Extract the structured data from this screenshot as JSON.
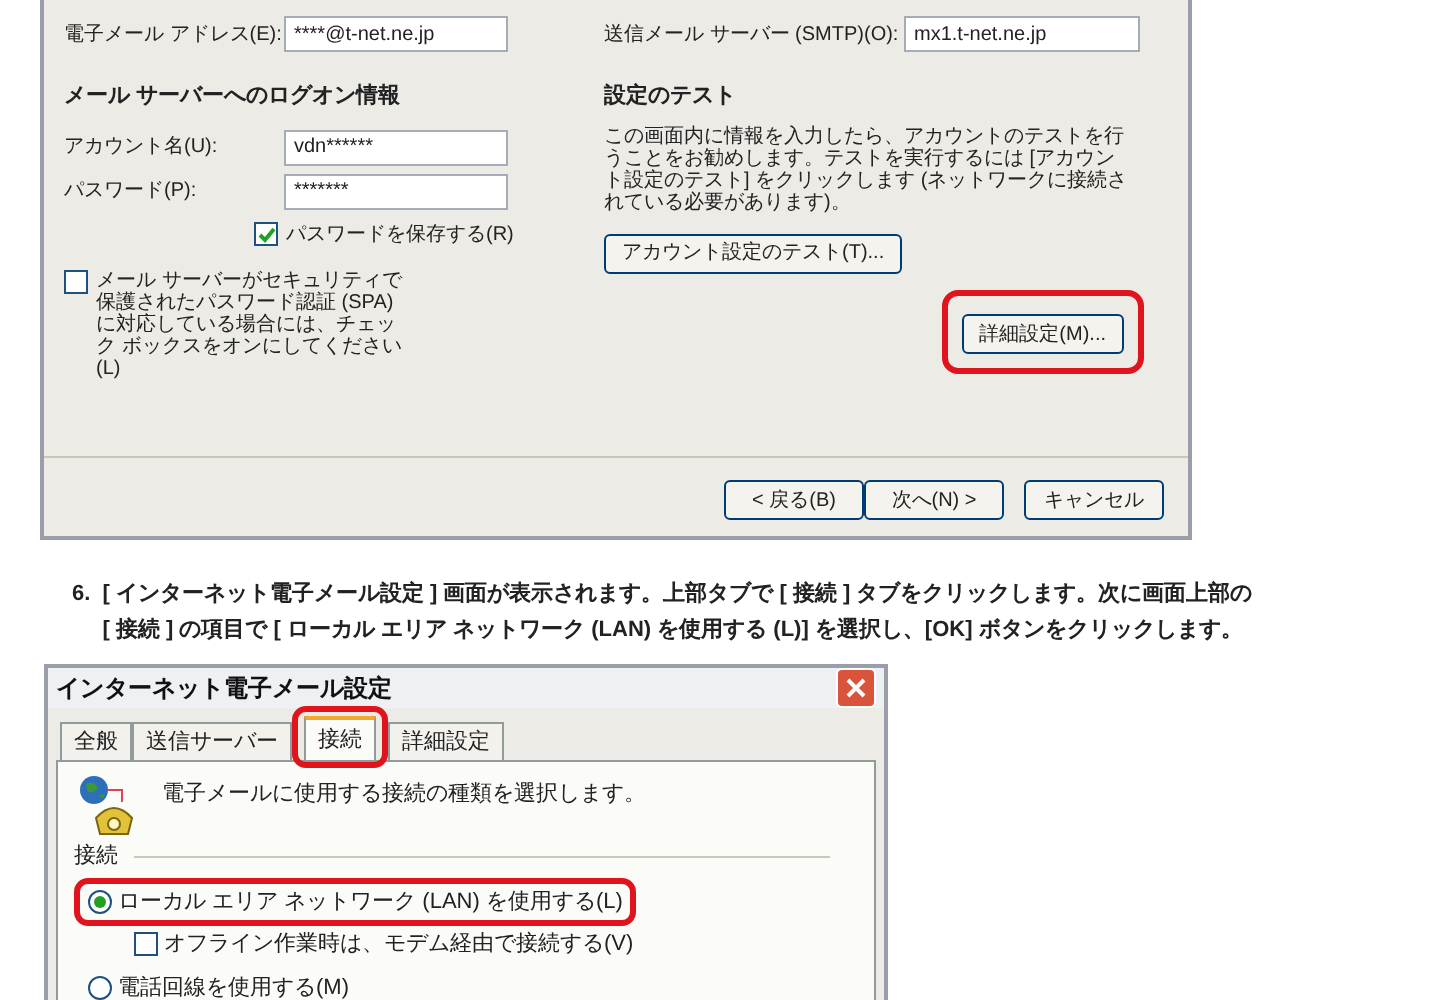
{
  "account_dialog": {
    "email": {
      "label": "電子メール アドレス(E):",
      "value": "****@t-net.ne.jp"
    },
    "smtp": {
      "label": "送信メール サーバー (SMTP)(O):",
      "value": "mx1.t-net.ne.jp"
    },
    "logon_section": {
      "title": "メール サーバーへのログオン情報",
      "account": {
        "label": "アカウント名(U):",
        "value": "vdn******"
      },
      "password": {
        "label": "パスワード(P):",
        "value": "*******"
      },
      "save_password": {
        "label": "パスワードを保存する(R)",
        "checked": true
      },
      "spa": {
        "label": "メール サーバーがセキュリティで保護されたパスワード認証 (SPA) に対応している場合には、チェック ボックスをオンにしてください(L)",
        "checked": false
      }
    },
    "test_section": {
      "title": "設定のテスト",
      "description": "この画面内に情報を入力したら、アカウントのテストを行うことをお勧めします。テストを実行するには [アカウント設定のテスト] をクリックします (ネットワークに接続されている必要があります)。",
      "test_button": "アカウント設定のテスト(T)..."
    },
    "advanced_button": {
      "label": "詳細設定(M)...",
      "highlighted": true
    },
    "buttons": [
      {
        "label": "< 戻る(B)"
      },
      {
        "label": "次へ(N) >"
      },
      {
        "label": "キャンセル"
      }
    ]
  },
  "step": {
    "number": "6.",
    "lines": [
      "[ インターネット電子メール設定 ] 画面が表示されます。上部タブで [ 接続 ] タブをクリックします。次に画面上部の",
      "[ 接続 ] の項目で [ ローカル エリア ネットワーク (LAN) を使用する (L)] を選択し、[OK] ボタンをクリックします。"
    ]
  },
  "internet_mail_dialog": {
    "title": "インターネット電子メール設定",
    "tabs": [
      {
        "label": "全般",
        "selected": false,
        "highlighted": false
      },
      {
        "label": "送信サーバー",
        "selected": false,
        "highlighted": false
      },
      {
        "label": "接続",
        "selected": true,
        "highlighted": true
      },
      {
        "label": "詳細設定",
        "selected": false,
        "highlighted": false
      }
    ],
    "description": "電子メールに使用する接続の種類を選択します。",
    "section_label": "接続",
    "options": [
      {
        "kind": "radio",
        "label": "ローカル エリア ネットワーク (LAN) を使用する(L)",
        "selected": true,
        "highlighted": true
      },
      {
        "kind": "checkbox",
        "label": "オフライン作業時は、モデム経由で接続する(V)",
        "checked": false
      },
      {
        "kind": "radio",
        "label": "電話回線を使用する(M)",
        "selected": false,
        "highlighted": false
      }
    ]
  }
}
